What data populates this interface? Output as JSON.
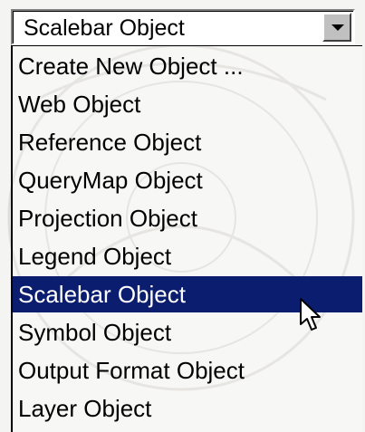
{
  "dropdown": {
    "selected_value": "Scalebar Object",
    "open_button_icon": "chevron-down-icon"
  },
  "options": [
    {
      "label": "Create New Object ...",
      "selected": false
    },
    {
      "label": "Web Object",
      "selected": false
    },
    {
      "label": "Reference Object",
      "selected": false
    },
    {
      "label": "QueryMap Object",
      "selected": false
    },
    {
      "label": "Projection Object",
      "selected": false
    },
    {
      "label": "Legend Object",
      "selected": false
    },
    {
      "label": "Scalebar Object",
      "selected": true
    },
    {
      "label": "Symbol Object",
      "selected": false
    },
    {
      "label": "Output Format Object",
      "selected": false
    },
    {
      "label": "Layer Object",
      "selected": false
    }
  ],
  "colors": {
    "highlight": "#0a1d6e",
    "highlight_text": "#ffffff",
    "button_face": "#c0c0c0"
  },
  "cursor_icon": "mouse-pointer-icon"
}
